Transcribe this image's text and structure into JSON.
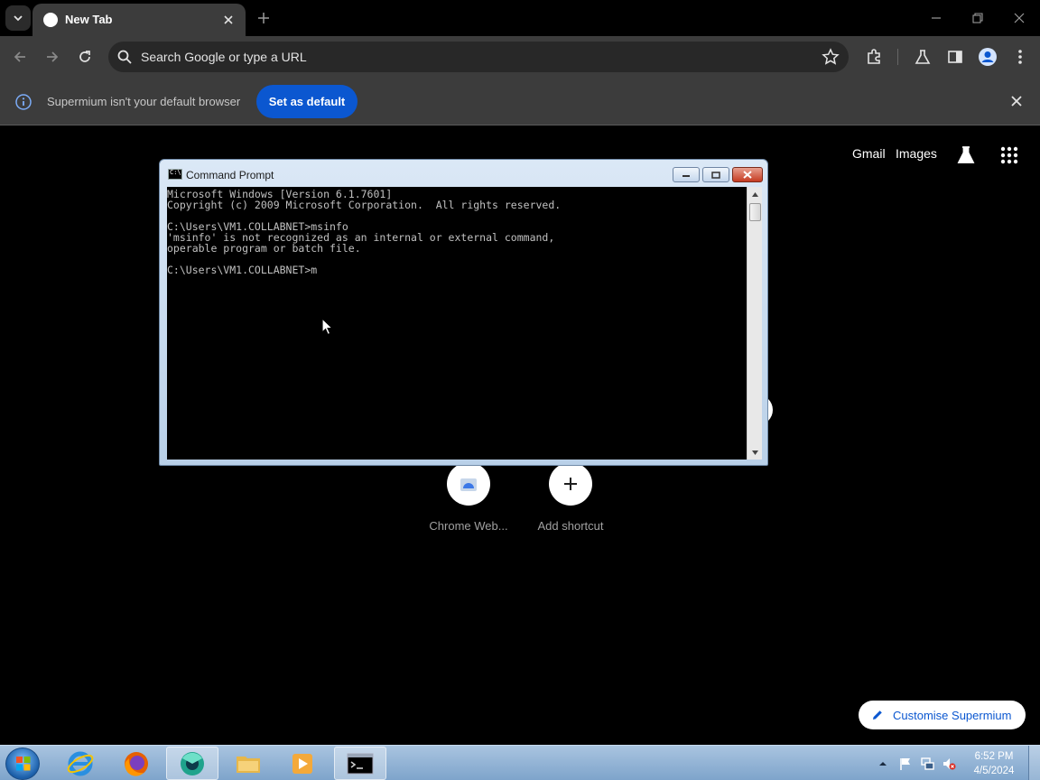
{
  "browser": {
    "tab": {
      "title": "New Tab"
    },
    "omnibox": {
      "placeholder": "Search Google or type a URL"
    },
    "infobar": {
      "message": "Supermium isn't your default browser",
      "button_label": "Set as default"
    }
  },
  "ntp": {
    "links": [
      "Gmail",
      "Images"
    ],
    "shortcuts": [
      {
        "label": "Chrome Web..."
      },
      {
        "label": "Add shortcut"
      }
    ],
    "customise_label": "Customise Supermium"
  },
  "cmd": {
    "title": "Command Prompt",
    "title_icon_text": "C:\\",
    "lines": [
      "Microsoft Windows [Version 6.1.7601]",
      "Copyright (c) 2009 Microsoft Corporation.  All rights reserved.",
      "",
      "C:\\Users\\VM1.COLLABNET>msinfo",
      "'msinfo' is not recognized as an internal or external command,",
      "operable program or batch file.",
      "",
      "C:\\Users\\VM1.COLLABNET>m"
    ]
  },
  "taskbar": {
    "clock_time": "6:52 PM",
    "clock_date": "4/5/2024"
  },
  "colors": {
    "accent": "#0b57d0",
    "toolbar": "#3c3c3c",
    "console_text": "#c0c0c0"
  }
}
